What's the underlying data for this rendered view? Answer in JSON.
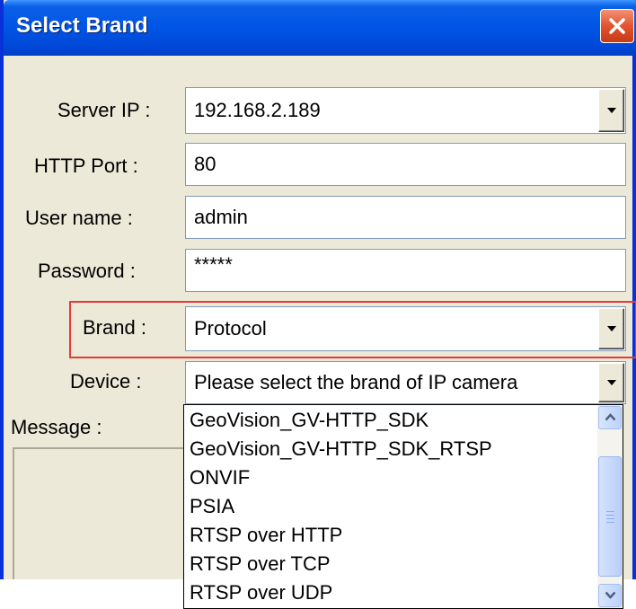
{
  "window": {
    "title": "Select Brand"
  },
  "form": {
    "server_ip": {
      "label": "Server IP :",
      "value": "192.168.2.189"
    },
    "http_port": {
      "label": "HTTP Port :",
      "value": "80"
    },
    "username": {
      "label": "User name :",
      "value": "admin"
    },
    "password": {
      "label": "Password :",
      "value": "*****"
    },
    "brand": {
      "label": "Brand :",
      "value": "Protocol"
    },
    "device": {
      "label": "Device :",
      "value": "Please select the brand of IP camera"
    },
    "message": {
      "label": "Message :"
    }
  },
  "brand_dropdown": {
    "options": [
      "GeoVision_GV-HTTP_SDK",
      "GeoVision_GV-HTTP_SDK_RTSP",
      "ONVIF",
      "PSIA",
      "RTSP over HTTP",
      "RTSP over TCP",
      "RTSP over UDP"
    ]
  },
  "icons": {
    "close": "close-icon",
    "dropdown": "chevron-down-icon",
    "scroll_up": "arrow-up-icon",
    "scroll_down": "arrow-down-icon"
  },
  "colors": {
    "titlebar": "#0055e5",
    "close_button": "#e2532f",
    "highlight": "#e53a3a",
    "window_bg": "#ece9d8"
  }
}
